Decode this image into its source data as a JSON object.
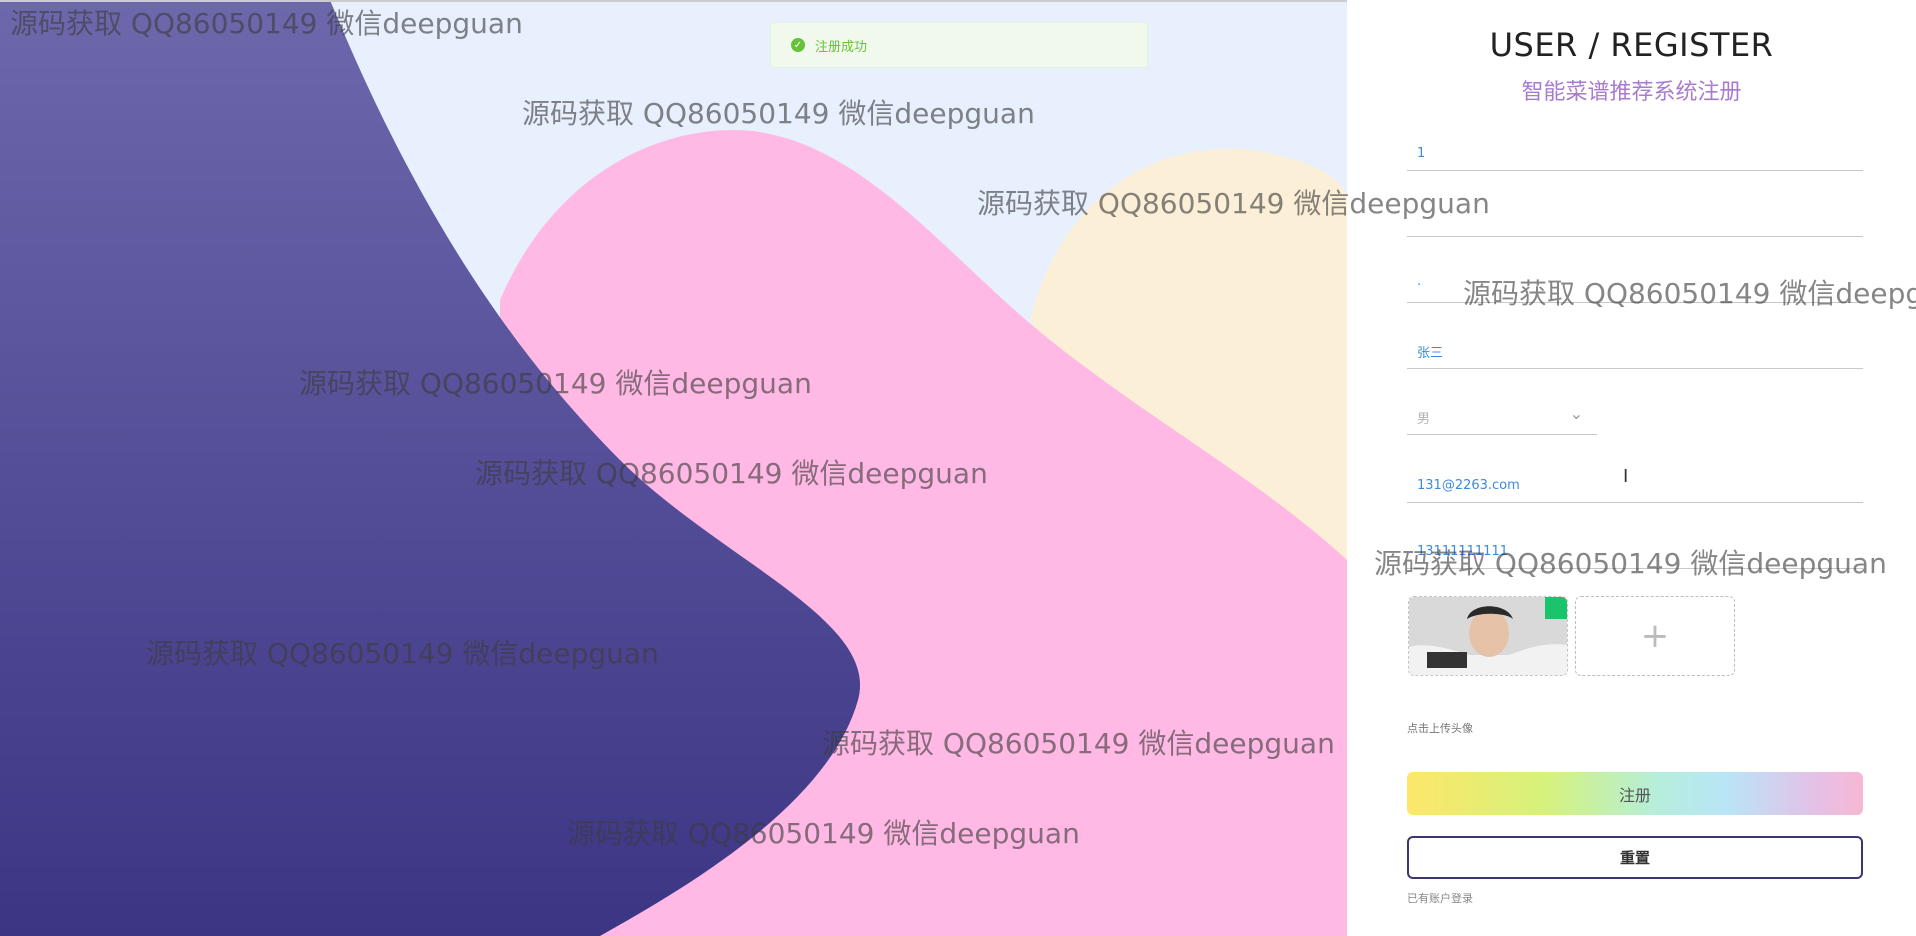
{
  "toast": {
    "text": "注册成功",
    "icon": "check-circle-icon",
    "color": "#67c23a"
  },
  "form": {
    "title": "USER / REGISTER",
    "subtitle": "智能菜谱推荐系统注册",
    "fields": [
      {
        "name": "account",
        "value": "1"
      },
      {
        "name": "password",
        "value": ""
      },
      {
        "name": "confirm_password",
        "value": "·"
      },
      {
        "name": "realname",
        "value": "张三"
      },
      {
        "name": "email",
        "value": "131@2263.com"
      },
      {
        "name": "phone",
        "value": "13111111111"
      }
    ],
    "gender": {
      "value": "男"
    },
    "upload": {
      "hint": "点击上传头像",
      "plus": "+"
    },
    "buttons": {
      "register": "注册",
      "reset": "重置"
    },
    "login_link": "已有账户登录"
  },
  "watermark": "源码获取 QQ86050149 微信deepguan",
  "colors": {
    "dark_blob": "#403c86",
    "pink_blob": "#ffb9e4",
    "cream_blob": "#fbefd8",
    "background": "#e8f0fe",
    "accent_purple": "#a77bd0"
  }
}
